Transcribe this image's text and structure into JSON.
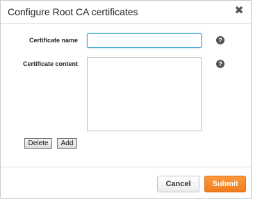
{
  "dialog": {
    "title": "Configure Root CA certificates",
    "close_glyph": "✖"
  },
  "form": {
    "name_label": "Certificate name",
    "name_value": "",
    "content_label": "Certificate content",
    "content_value": "",
    "help_glyph": "?"
  },
  "actions": {
    "delete_label": "Delete",
    "add_label": "Add"
  },
  "footer": {
    "cancel_label": "Cancel",
    "submit_label": "Submit"
  },
  "colors": {
    "submit_accent": "#f07c1b",
    "input_focus_border": "#3fa8d8"
  },
  "icons": {
    "close": "close-icon",
    "help": "help-icon"
  }
}
